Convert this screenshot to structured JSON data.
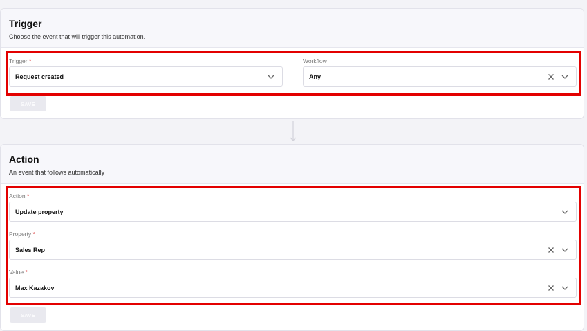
{
  "trigger_card": {
    "title": "Trigger",
    "subtitle": "Choose the event that will trigger this automation.",
    "fields": [
      {
        "label": "Trigger",
        "required": "*",
        "value": "Request created",
        "icons": [
          "chevron-down-icon"
        ]
      },
      {
        "label": "Workflow",
        "required": "",
        "value": "Any",
        "icons": [
          "clear-icon",
          "chevron-down-icon"
        ]
      }
    ],
    "save_label": "SAVE"
  },
  "action_card": {
    "title": "Action",
    "subtitle": "An event that follows automatically",
    "fields": [
      {
        "label": "Action",
        "required": "*",
        "value": "Update property",
        "icons": [
          "chevron-down-icon"
        ]
      },
      {
        "label": "Property",
        "required": "*",
        "value": "Sales Rep",
        "icons": [
          "clear-icon",
          "chevron-down-icon"
        ]
      },
      {
        "label": "Value",
        "required": "*",
        "value": "Max Kazakov",
        "icons": [
          "clear-icon",
          "chevron-down-icon"
        ]
      }
    ],
    "save_label": "SAVE"
  },
  "colors": {
    "highlight": "#e30000",
    "required_asterisk": "#d62a2a",
    "page_background": "#f3f3f7",
    "disabled_button": "#e9e9ef"
  }
}
